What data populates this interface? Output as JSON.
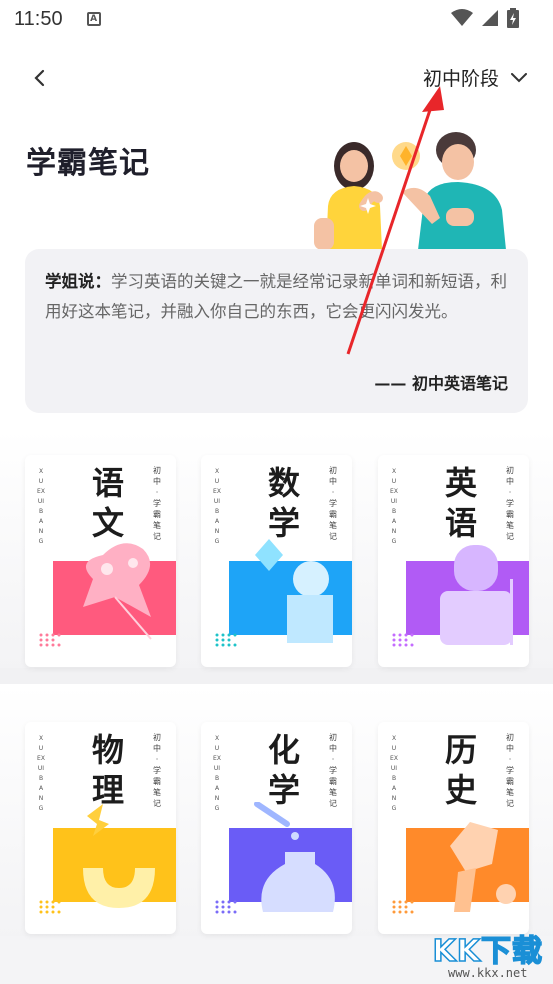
{
  "status_bar": {
    "time": "11:50",
    "notif_icon": "A"
  },
  "nav": {
    "stage": "初中阶段"
  },
  "page": {
    "title": "学霸笔记"
  },
  "quote": {
    "label": "学姐说：",
    "text": "学习英语的关键之一就是经常记录新单词和新短语，利用好这本笔记，并融入你自己的东西，它会更闪闪发光。",
    "source": "—— 初中英语笔记"
  },
  "books": [
    {
      "subject": "语文",
      "vert": "XUEXUIBANG",
      "series": "初中·学霸笔记",
      "color": "#ff5a7e"
    },
    {
      "subject": "数学",
      "vert": "XUEXUIBANG",
      "series": "初中·学霸笔记",
      "color": "#1ea4f7"
    },
    {
      "subject": "英语",
      "vert": "XUEXUIBANG",
      "series": "初中·学霸笔记",
      "color": "#b15bf5"
    },
    {
      "subject": "物理",
      "vert": "XUEXUIBANG",
      "series": "初中·学霸笔记",
      "color": "#ffc21a"
    },
    {
      "subject": "化学",
      "vert": "XUEXUIBANG",
      "series": "初中·学霸笔记",
      "color": "#6a5cf6"
    },
    {
      "subject": "历史",
      "vert": "XUEXUIBANG",
      "series": "初中·学霸笔记",
      "color": "#ff8a2a"
    }
  ],
  "watermark": {
    "title": "KK下载",
    "url": "www.kkx.net"
  },
  "colors": {
    "annotation_arrow": "#e8262a",
    "card_bg": "#f2f2f5"
  }
}
